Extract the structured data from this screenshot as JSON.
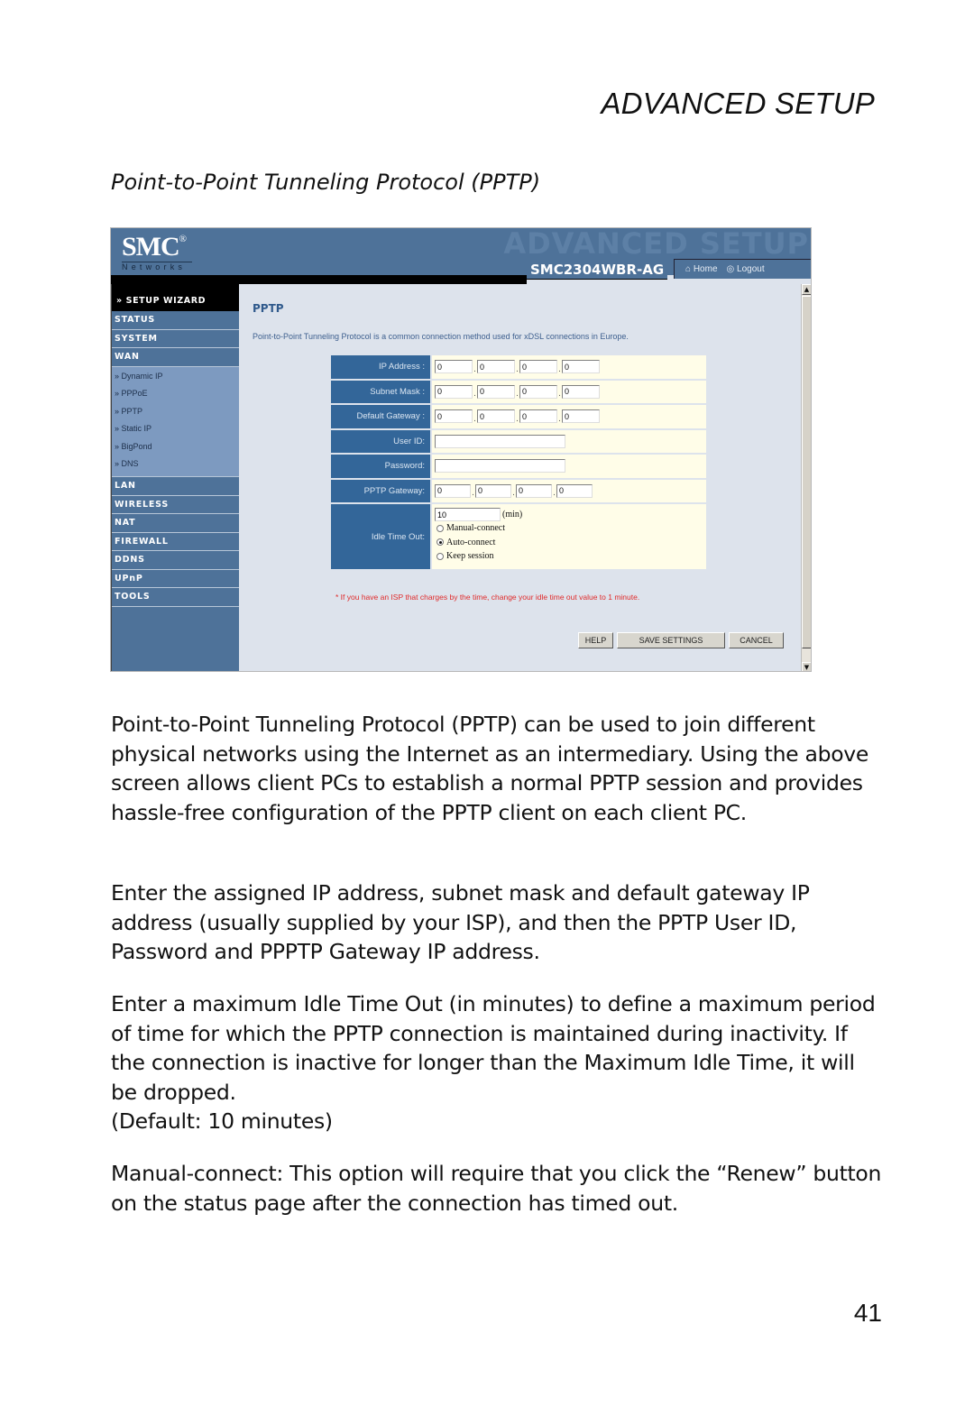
{
  "page": {
    "section_header": "ADVANCED SETUP",
    "subtitle": "Point-to-Point Tunneling Protocol (PPTP)",
    "page_number": "41",
    "paragraphs": [
      "Point-to-Point Tunneling Protocol (PPTP) can be used to join different physical networks using the Internet as an intermediary. Using the above screen allows client PCs to establish a normal PPTP session and provides hassle-free configuration of the PPTP client on each client PC.",
      "Enter the assigned IP address, subnet mask and default gateway IP address (usually supplied by your ISP), and then the PPTP User ID, Password and PPPTP Gateway IP address.",
      "Enter a maximum Idle Time Out (in minutes) to define a maximum period of time for which the PPTP connection is maintained during inactivity. If the connection is inactive for longer than the Maximum Idle Time, it will be dropped.",
      "(Default: 10 minutes)",
      "Manual-connect: This option will require that you click the “Renew” button on the status page after the connection has timed out."
    ]
  },
  "router_ui": {
    "logo": "SMC",
    "logo_mark": "®",
    "logo_sub": "Networks",
    "banner_watermark": "ADVANCED SETUP",
    "model": "SMC2304WBR-AG",
    "top_links": [
      {
        "icon": "home-icon",
        "glyph": "⌂",
        "label": "Home"
      },
      {
        "icon": "logout-icon",
        "glyph": "◎",
        "label": "Logout"
      }
    ],
    "sidebar": {
      "top_item": "» SETUP WIZARD",
      "items_before": [
        "STATUS",
        "SYSTEM",
        "WAN"
      ],
      "wan_sub": [
        "» Dynamic IP",
        "» PPPoE",
        "» PPTP",
        "» Static IP",
        "» BigPond",
        "» DNS"
      ],
      "items_after": [
        "LAN",
        "WIRELESS",
        "NAT",
        "FIREWALL",
        "DDNS",
        "UPnP",
        "TOOLS"
      ]
    },
    "content": {
      "title": "PPTP",
      "description": "Point-to-Point Tunneling Protocol is a common connection method used for xDSL connections in Europe.",
      "fields": {
        "ip_address": {
          "label": "IP Address :",
          "octets": [
            "0",
            "0",
            "0",
            "0"
          ]
        },
        "subnet_mask": {
          "label": "Subnet Mask :",
          "octets": [
            "0",
            "0",
            "0",
            "0"
          ]
        },
        "default_gateway": {
          "label": "Default Gateway :",
          "octets": [
            "0",
            "0",
            "0",
            "0"
          ]
        },
        "user_id": {
          "label": "User ID:",
          "value": ""
        },
        "password": {
          "label": "Password:",
          "value": ""
        },
        "pptp_gateway": {
          "label": "PPTP Gateway:",
          "octets": [
            "0",
            "0",
            "0",
            "0"
          ]
        },
        "idle_timeout": {
          "label": "Idle Time Out:",
          "value": "10",
          "unit": "(min)",
          "options": [
            "Manual-connect",
            "Auto-connect",
            "Keep session"
          ],
          "selected": "Auto-connect"
        }
      },
      "note": "* If you have an ISP that charges by the time, change your idle time out value to 1 minute.",
      "buttons": {
        "help": "HELP",
        "save": "SAVE SETTINGS",
        "cancel": "CANCEL"
      }
    },
    "colors": {
      "banner": "#4e7299",
      "label_cell": "#336699",
      "value_cell": "#fffde8",
      "content_bg": "#dde3ec",
      "note_red": "#e02a2a"
    }
  }
}
